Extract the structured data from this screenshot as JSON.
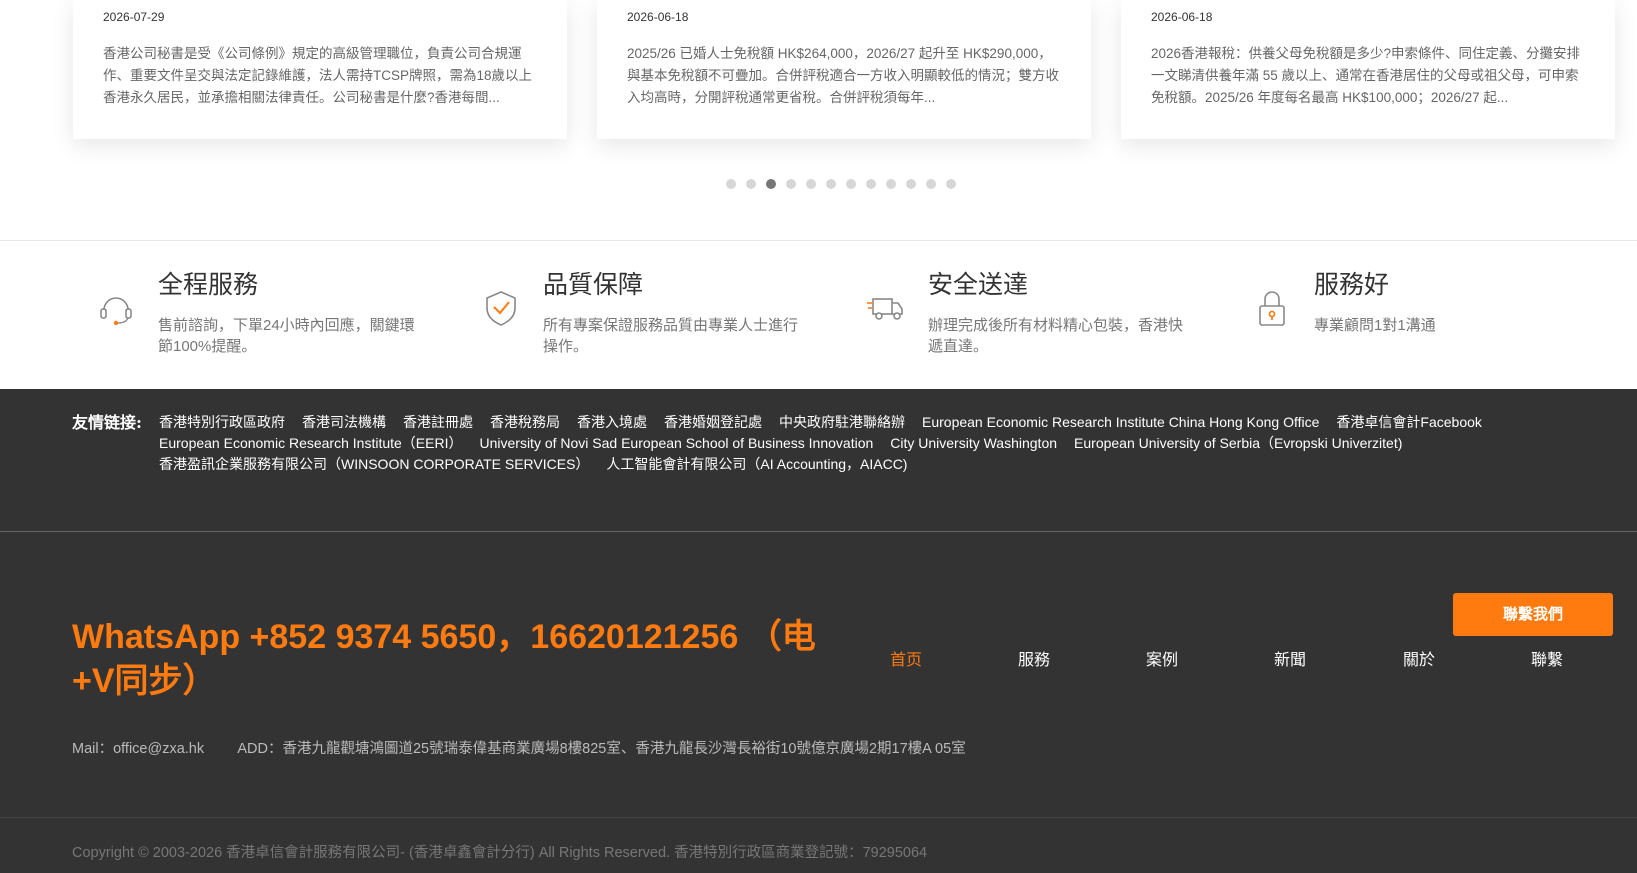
{
  "articles": [
    {
      "date": "2026-07-29",
      "excerpt": "香港公司秘書是受《公司條例》規定的高級管理職位，負責公司合規運作、重要文件呈交與法定記錄維護，法人需持TCSP牌照，需為18歲以上香港永久居民，並承擔相關法律責任。公司秘書是什麼?香港每間..."
    },
    {
      "date": "2026-06-18",
      "excerpt": "2025/26 已婚人士免稅額 HK$264,000，2026/27 起升至 HK$290,000，與基本免稅額不可疊加。合併評稅適合一方收入明顯較低的情況；雙方收入均高時，分開評稅通常更省稅。合併評稅須每年..."
    },
    {
      "date": "2026-06-18",
      "excerpt": "2026香港報稅：供養父母免稅額是多少?申索條件、同住定義、分攤安排一文睇清供養年滿 55 歲以上、通常在香港居住的父母或祖父母，可申索免稅額。2025/26 年度每名最高 HK$100,000；2026/27 起..."
    }
  ],
  "carousel": {
    "total_dots": 12,
    "active_index": 2
  },
  "features": [
    {
      "title": "全程服務",
      "desc": "售前諮詢，下單24小時內回應，關鍵環節100%提醒。",
      "icon": "headset-icon"
    },
    {
      "title": "品質保障",
      "desc": "所有專案保證服務品質由專業人士進行操作。",
      "icon": "shield-check-icon"
    },
    {
      "title": "安全送達",
      "desc": "辦理完成後所有材料精心包裝，香港快遞直達。",
      "icon": "delivery-truck-icon"
    },
    {
      "title": "服務好",
      "desc": "專業顧問1對1溝通",
      "icon": "lock-icon"
    }
  ],
  "friend_links": {
    "label": "友情链接:",
    "items": [
      "香港特別行政區政府",
      "香港司法機構",
      "香港註冊處",
      "香港稅務局",
      "香港入境處",
      "香港婚姻登記處",
      "中央政府駐港聯絡辦",
      "European Economic Research Institute China Hong Kong Office",
      "香港卓信會計Facebook",
      "European Economic Research Institute（EERI）",
      "University of Novi Sad European School of Business Innovation",
      "City University Washington",
      "European University of Serbia（Evropski Univerzitet)",
      "香港盈訊企業服務有限公司（WINSOON CORPORATE SERVICES）",
      "人工智能會計有限公司（AI Accounting，AIACC)"
    ]
  },
  "footer": {
    "whatsapp": "WhatsApp +852 9374 5650，16620121256 （电+V同步）",
    "contact_button": "聯繫我們",
    "nav": [
      "首页",
      "服務",
      "案例",
      "新聞",
      "關於",
      "聯繫"
    ],
    "nav_active_index": 0,
    "mail": "Mail：office@zxa.hk",
    "address": "ADD：香港九龍觀塘鴻圖道25號瑞泰偉基商業廣場8樓825室、香港九龍長沙灣長裕街10號億京廣場2期17樓A 05室",
    "copyright": "Copyright © 2003-2026 香港卓信會計服務有限公司- (香港卓鑫會計分行) All Rights Reserved.  香港特別行政區商業登記號：79295064"
  },
  "colors": {
    "accent": "#ff7a0f",
    "footer_bg": "#333333",
    "icon_gray": "#888888"
  }
}
